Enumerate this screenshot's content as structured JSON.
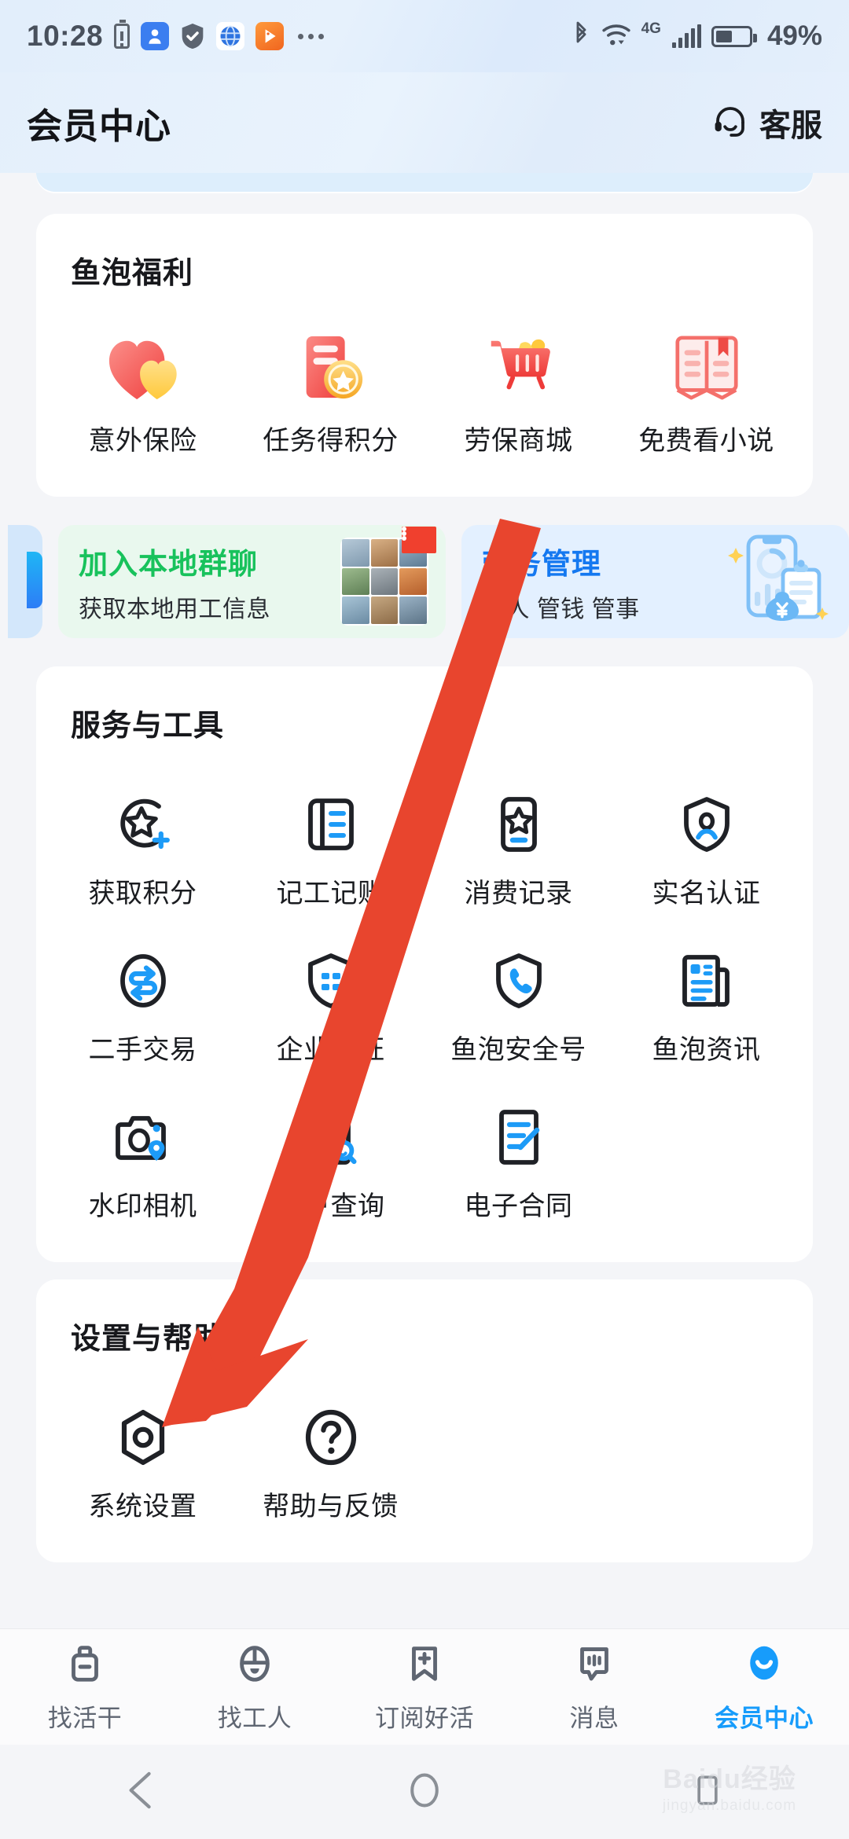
{
  "status_bar": {
    "time": "10:28",
    "battery_percent": "49%",
    "network_type": "4G",
    "left_icons": [
      "battery-alert-icon",
      "location-app-icon",
      "shield-check-icon",
      "browser-globe-icon",
      "video-play-app-icon",
      "overflow-dots-icon"
    ],
    "right_icons": [
      "bluetooth-icon",
      "wifi-icon",
      "signal-bars-icon",
      "battery-icon"
    ]
  },
  "header": {
    "title": "会员中心",
    "support_label": "客服",
    "support_icon": "headset-icon"
  },
  "welfare_section": {
    "title": "鱼泡福利",
    "items": [
      {
        "label": "意外保险",
        "icon": "heart-insurance-icon"
      },
      {
        "label": "任务得积分",
        "icon": "task-coin-icon"
      },
      {
        "label": "劳保商城",
        "icon": "shopping-cart-icon"
      },
      {
        "label": "免费看小说",
        "icon": "open-book-icon"
      }
    ]
  },
  "banners": [
    {
      "title": "加入本地群聊",
      "subtitle": "获取本地用工信息",
      "theme": "green",
      "accent": "#18c25c",
      "badge_icon": "chat-dots-badge-icon",
      "thumb_icon": "photo-grid-icon"
    },
    {
      "title": "劳务管理",
      "subtitle": "管人 管钱 管事",
      "theme": "blue",
      "accent": "#1478f0",
      "illustration_icon": "phone-clipboard-money-icon"
    }
  ],
  "services_section": {
    "title": "服务与工具",
    "items": [
      {
        "label": "获取积分",
        "icon": "star-plus-icon"
      },
      {
        "label": "记工记账",
        "icon": "ledger-book-icon"
      },
      {
        "label": "消费记录",
        "icon": "star-card-icon"
      },
      {
        "label": "实名认证",
        "icon": "shield-person-icon"
      },
      {
        "label": "二手交易",
        "icon": "exchange-arrows-icon"
      },
      {
        "label": "企业认证",
        "icon": "shield-building-icon"
      },
      {
        "label": "鱼泡安全号",
        "icon": "shield-phone-icon"
      },
      {
        "label": "鱼泡资讯",
        "icon": "news-document-icon"
      },
      {
        "label": "水印相机",
        "icon": "camera-location-icon"
      },
      {
        "label": "用户查询",
        "icon": "person-search-icon"
      },
      {
        "label": "电子合同",
        "icon": "contract-pen-icon"
      }
    ]
  },
  "settings_section": {
    "title": "设置与帮助",
    "items": [
      {
        "label": "系统设置",
        "icon": "gear-hex-icon"
      },
      {
        "label": "帮助与反馈",
        "icon": "question-circle-icon"
      }
    ]
  },
  "tab_bar": {
    "active_index": 4,
    "active_color": "#179cfb",
    "inactive_color": "#5f6672",
    "items": [
      {
        "label": "找活干",
        "icon": "toolbox-icon"
      },
      {
        "label": "找工人",
        "icon": "hardhat-icon"
      },
      {
        "label": "订阅好活",
        "icon": "bookmark-plus-icon"
      },
      {
        "label": "消息",
        "icon": "chat-bubble-icon"
      },
      {
        "label": "会员中心",
        "icon": "member-avatar-icon"
      }
    ]
  },
  "android_nav": {
    "items": [
      {
        "icon": "back-triangle-icon"
      },
      {
        "icon": "home-circle-icon"
      },
      {
        "icon": "recents-square-icon"
      }
    ]
  },
  "watermark": {
    "line1": "Baidu经验",
    "line2": "jingyan.baidu.com"
  },
  "annotation": {
    "type": "arrow",
    "color": "#e8452e",
    "points_to": "系统设置"
  }
}
